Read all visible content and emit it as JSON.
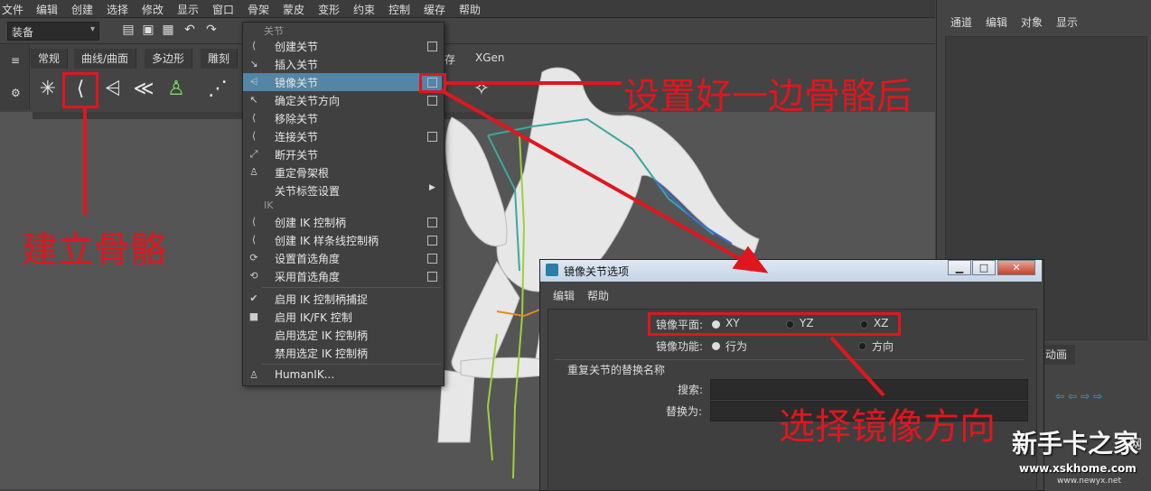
{
  "menubar": {
    "items": [
      "文件",
      "编辑",
      "创建",
      "选择",
      "修改",
      "显示",
      "窗口",
      "骨架",
      "蒙皮",
      "变形",
      "约束",
      "控制",
      "缓存",
      "帮助"
    ]
  },
  "statusline": {
    "mode_value": "装备",
    "mode_arrow": "▾",
    "tool_icons": [
      "new-scene-icon",
      "open-icon",
      "save-icon",
      "undo-icon",
      "redo-icon"
    ],
    "tool_glyphs": [
      "▤",
      "▣",
      "▦",
      "↶",
      "↷"
    ]
  },
  "shelf": {
    "side_glyphs": [
      "≡",
      "⚙"
    ],
    "tabs": [
      "常规",
      "曲线/曲面",
      "多边形",
      "雕刻"
    ],
    "tab_right": [
      "存",
      "XGen"
    ],
    "icons": [
      {
        "name": "joint-star-icon",
        "glyph": "✳"
      },
      {
        "name": "create-joint-icon",
        "glyph": "⟨"
      },
      {
        "name": "mirror-joint-icon",
        "glyph": "⩤"
      },
      {
        "name": "orient-joint-icon",
        "glyph": "≪"
      },
      {
        "name": "humanik-icon",
        "glyph": "♙"
      },
      {
        "name": "bind-skin-icon",
        "glyph": "⋰"
      },
      {
        "name": "ik-handle-icon",
        "glyph": "✧"
      }
    ]
  },
  "rightpanel": {
    "tabs": [
      "通道",
      "编辑",
      "对象",
      "显示"
    ],
    "anim_tab": "动画",
    "layer_icons": "⇦⇦⇨⇨"
  },
  "jointmenu": {
    "section_joint": "关节",
    "section_ik": "IK",
    "items": [
      {
        "label": "创建关节",
        "option": true
      },
      {
        "label": "插入关节",
        "option": false
      },
      {
        "label": "镜像关节",
        "option": true,
        "highlight": true
      },
      {
        "label": "确定关节方向",
        "option": true
      },
      {
        "label": "移除关节",
        "option": false
      },
      {
        "label": "连接关节",
        "option": true
      },
      {
        "label": "断开关节",
        "option": false
      },
      {
        "label": "重定骨架根",
        "option": false
      },
      {
        "label": "关节标签设置",
        "option": false,
        "submenu": true
      }
    ],
    "ik_items": [
      {
        "label": "创建 IK 控制柄",
        "option": true
      },
      {
        "label": "创建 IK 样条线控制柄",
        "option": true
      },
      {
        "label": "设置首选角度",
        "option": true
      },
      {
        "label": "采用首选角度",
        "option": true
      }
    ],
    "toggle_items": [
      {
        "label": "启用 IK 控制柄捕捉",
        "checked": true
      },
      {
        "label": "启用 IK/FK 控制",
        "checked": false
      },
      {
        "label": "启用选定 IK 控制柄"
      },
      {
        "label": "禁用选定 IK 控制柄"
      }
    ],
    "humanik": "HumanIK..."
  },
  "dialog": {
    "title": "镜像关节选项",
    "menu": [
      "编辑",
      "帮助"
    ],
    "window_buttons": {
      "minimize": "▁",
      "maximize": "□",
      "close": "✕"
    },
    "mirror_plane_label": "镜像平面:",
    "mirror_plane_options": [
      "XY",
      "YZ",
      "XZ"
    ],
    "mirror_plane_selected": "XY",
    "mirror_function_label": "镜像功能:",
    "mirror_function_options": [
      "行为",
      "方向"
    ],
    "mirror_function_selected": "行为",
    "replace_group_title": "重复关节的替换名称",
    "search_label": "搜索:",
    "search_value": "",
    "replace_label": "替换为:",
    "replace_value": ""
  },
  "annotations": {
    "create_skeleton": "建立骨骼",
    "after_one_side": "设置好一边骨骼后",
    "choose_direction": "选择镜像方向",
    "color": "#e0161e"
  },
  "watermark": {
    "brand": "新手卡之家",
    "url": "www.xskhome.com",
    "url2": "www.newyx.net",
    "net": "网"
  }
}
